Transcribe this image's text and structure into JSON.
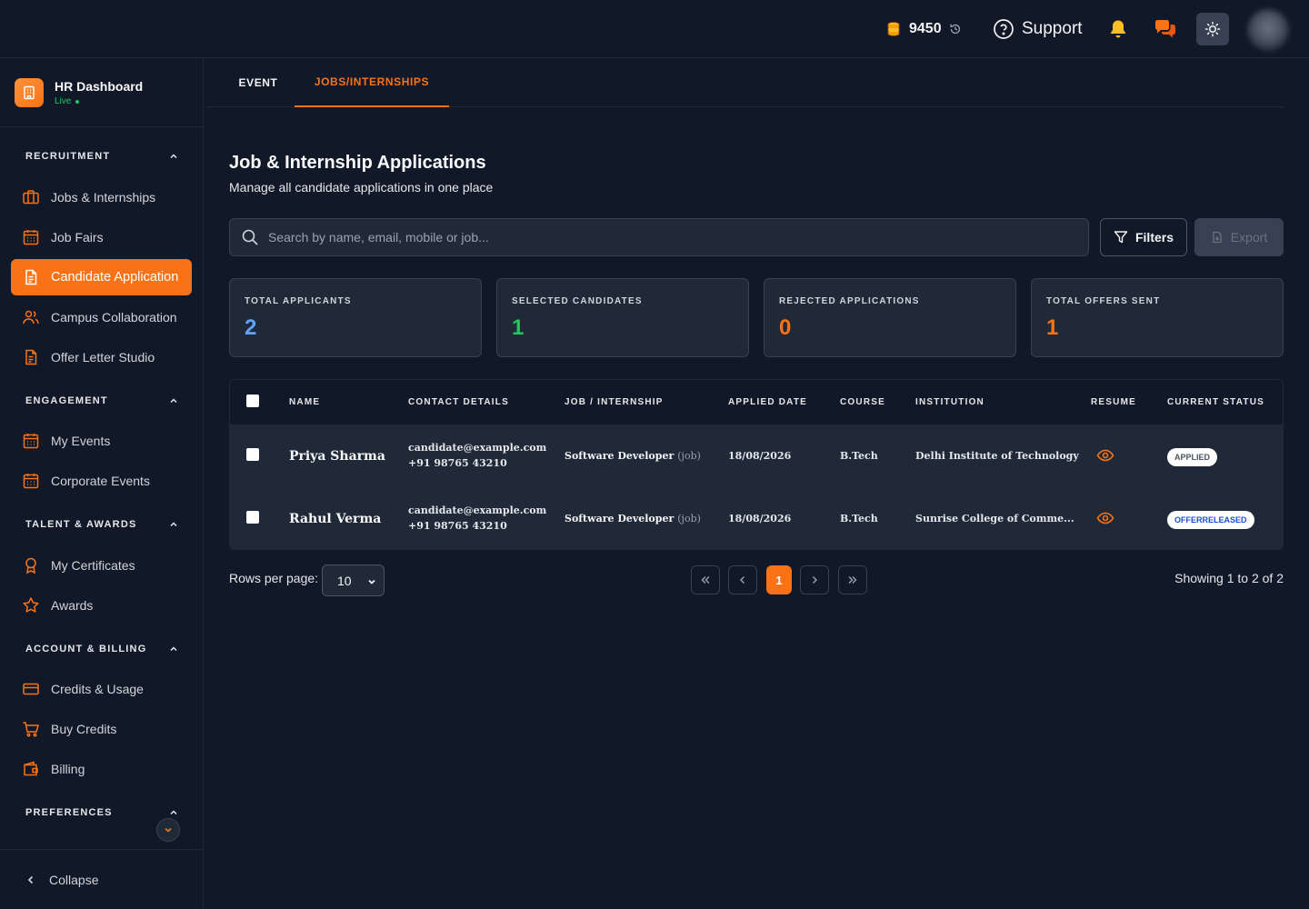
{
  "topbar": {
    "credits": "9450",
    "support_label": "Support",
    "icons": [
      "coins-icon",
      "history-icon",
      "help-circle-icon",
      "bell-icon",
      "chat-icon",
      "sun-icon"
    ]
  },
  "brand": {
    "title": "HR Dashboard",
    "status": "Live"
  },
  "sidebar": {
    "sections": [
      {
        "title": "RECRUITMENT",
        "items": [
          {
            "label": "Jobs & Internships",
            "icon": "briefcase-icon"
          },
          {
            "label": "Job Fairs",
            "icon": "calendar-icon"
          },
          {
            "label": "Candidate Application",
            "icon": "document-icon",
            "active": true
          },
          {
            "label": "Campus Collaboration",
            "icon": "users-icon"
          },
          {
            "label": "Offer Letter Studio",
            "icon": "file-text-icon"
          }
        ]
      },
      {
        "title": "ENGAGEMENT",
        "items": [
          {
            "label": "My Events",
            "icon": "calendar-icon"
          },
          {
            "label": "Corporate Events",
            "icon": "calendar-icon"
          }
        ]
      },
      {
        "title": "TALENT & AWARDS",
        "items": [
          {
            "label": "My Certificates",
            "icon": "award-icon"
          },
          {
            "label": "Awards",
            "icon": "star-icon"
          }
        ]
      },
      {
        "title": "ACCOUNT & BILLING",
        "items": [
          {
            "label": "Credits & Usage",
            "icon": "credit-card-icon"
          },
          {
            "label": "Buy Credits",
            "icon": "cart-icon"
          },
          {
            "label": "Billing",
            "icon": "wallet-icon"
          }
        ]
      },
      {
        "title": "PREFERENCES",
        "items": []
      }
    ],
    "collapse_label": "Collapse"
  },
  "tabs": [
    {
      "label": "EVENT",
      "active": false
    },
    {
      "label": "JOBS/INTERNSHIPS",
      "active": true
    }
  ],
  "main": {
    "title": "Job & Internship Applications",
    "subtitle": "Manage all candidate applications in one place",
    "search_placeholder": "Search by name, email, mobile or job...",
    "filters_label": "Filters",
    "export_label": "Export"
  },
  "stats": [
    {
      "label": "TOTAL APPLICANTS",
      "value": "2",
      "color": "#60a5fa"
    },
    {
      "label": "SELECTED CANDIDATES",
      "value": "1",
      "color": "#22c55e"
    },
    {
      "label": "REJECTED APPLICATIONS",
      "value": "0",
      "color": "#f97316"
    },
    {
      "label": "TOTAL OFFERS SENT",
      "value": "1",
      "color": "#f97316"
    }
  ],
  "table": {
    "headers": [
      "NAME",
      "CONTACT DETAILS",
      "JOB / INTERNSHIP",
      "APPLIED DATE",
      "COURSE",
      "INSTITUTION",
      "RESUME",
      "CURRENT STATUS"
    ],
    "rows": [
      {
        "name": "Priya Sharma",
        "email": "candidate@example.com",
        "phone": "+91 98765 43210",
        "job": "Software Developer",
        "job_type": "(job)",
        "date": "18/08/2026",
        "course": "B.Tech",
        "institution": "Delhi Institute of Technology",
        "status": "APPLIED",
        "status_color": "#4b5563"
      },
      {
        "name": "Rahul Verma",
        "email": "candidate@example.com",
        "phone": "+91 98765 43210",
        "job": "Software Developer",
        "job_type": "(job)",
        "date": "18/08/2026",
        "course": "B.Tech",
        "institution": "Sunrise College of Comme...",
        "status": "OFFERRELEASED",
        "status_color": "#1d4ed8"
      }
    ]
  },
  "footer": {
    "rows_per_page_label": "Rows per page:",
    "rows_per_page": "10",
    "current_page": "1",
    "showing": "Showing 1 to 2 of 2"
  },
  "colors": {
    "accent": "#f97316",
    "background": "#111827",
    "surface": "#1f2937"
  }
}
